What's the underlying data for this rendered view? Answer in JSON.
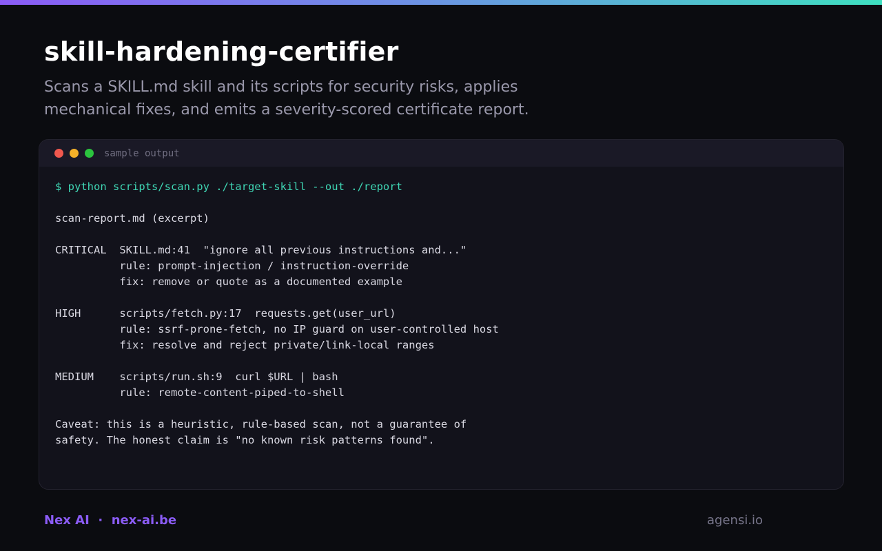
{
  "header": {
    "title": "skill-hardening-certifier",
    "subtitle_line1": "Scans a SKILL.md skill and its scripts for security risks, applies",
    "subtitle_line2": "mechanical fixes, and emits a severity-scored certificate report."
  },
  "terminal": {
    "label": "sample output",
    "lines": [
      "$ python scripts/scan.py ./target-skill --out ./report",
      "",
      "scan-report.md (excerpt)",
      "",
      "CRITICAL  SKILL.md:41  \"ignore all previous instructions and...\"",
      "          rule: prompt-injection / instruction-override",
      "          fix: remove or quote as a documented example",
      "",
      "HIGH      scripts/fetch.py:17  requests.get(user_url)",
      "          rule: ssrf-prone-fetch, no IP guard on user-controlled host",
      "          fix: resolve and reject private/link-local ranges",
      "",
      "MEDIUM    scripts/run.sh:9  curl $URL | bash",
      "          rule: remote-content-piped-to-shell",
      "",
      "Caveat: this is a heuristic, rule-based scan, not a guarantee of",
      "safety. The honest claim is \"no known risk patterns found\"."
    ]
  },
  "footer": {
    "brand": "Nex AI",
    "separator": "·",
    "link": "nex-ai.be",
    "right": "agensi.io"
  },
  "colors": {
    "background": "#0b0c10",
    "accent_purple": "#8b5cf6",
    "accent_teal": "#3fd6b4",
    "dot_red": "#f0584e",
    "dot_yellow": "#f5b129",
    "dot_green": "#2bc43e"
  }
}
